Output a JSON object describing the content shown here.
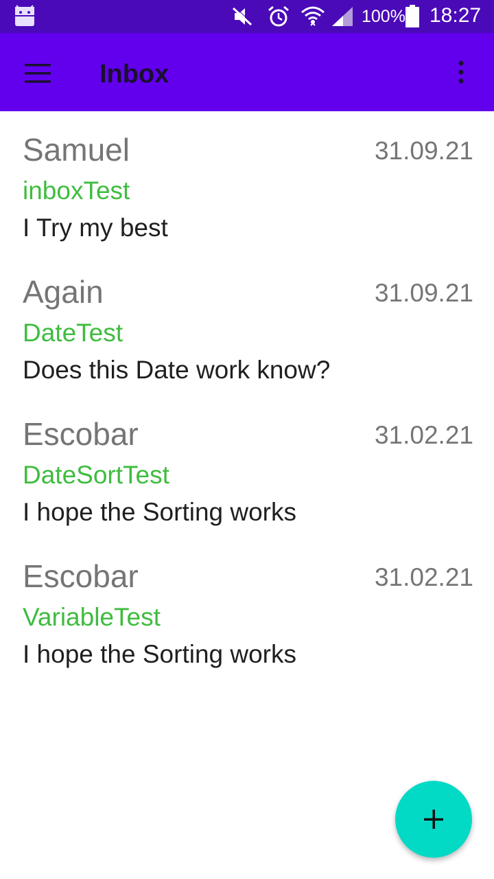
{
  "status_bar": {
    "battery_percent": "100%",
    "time": "18:27",
    "icons": [
      "android-app-icon",
      "mute-icon",
      "alarm-icon",
      "wifi-icon",
      "signal-icon",
      "battery-icon"
    ],
    "background_color": "#4a0ab8"
  },
  "app_bar": {
    "title": "Inbox",
    "left_icon": "menu-icon",
    "right_icon": "more-vert-icon",
    "background_color": "#6200ee"
  },
  "messages": [
    {
      "sender": "Samuel",
      "date": "31.09.21",
      "subject": "inboxTest",
      "body": "I Try my best"
    },
    {
      "sender": "Again",
      "date": "31.09.21",
      "subject": "DateTest",
      "body": "Does this Date work know?"
    },
    {
      "sender": "Escobar",
      "date": "31.02.21",
      "subject": "DateSortTest",
      "body": "I hope the Sorting works"
    },
    {
      "sender": "Escobar",
      "date": "31.02.21",
      "subject": "VariableTest",
      "body": "I hope the Sorting works"
    }
  ],
  "fab": {
    "icon": "plus-icon",
    "color": "#03dac5"
  },
  "colors": {
    "subject": "#3fbc3f",
    "sender": "#757575",
    "body": "#1f1f1f"
  }
}
